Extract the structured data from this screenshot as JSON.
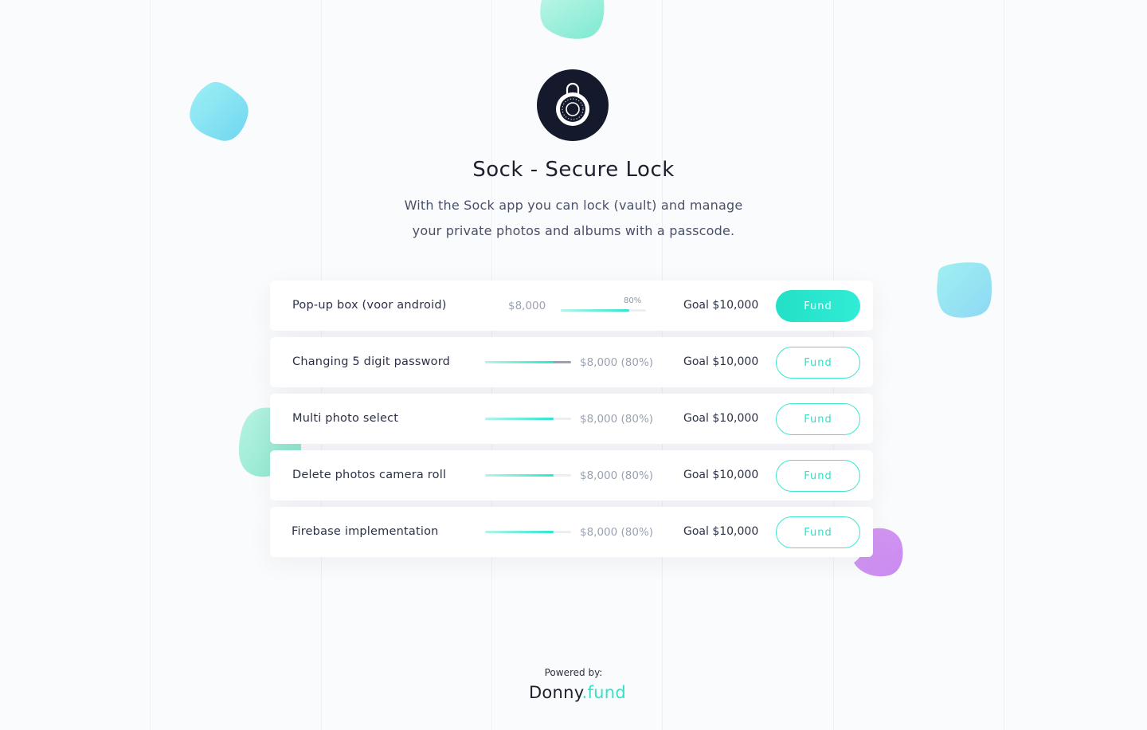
{
  "app": {
    "title": "Sock - Secure Lock",
    "description_line1": "With the Sock app you can lock (vault) and manage",
    "description_line2": "your private photos and albums with a passcode.",
    "logo_icon": "combination-lock-icon"
  },
  "colors": {
    "accent": "#2ee6cf",
    "logo_bg": "#141a2b",
    "blob_purple": "#c98cf0"
  },
  "features": [
    {
      "name": "Pop-up box (voor android)",
      "amount": "$8,000",
      "percent_label": "80%",
      "progress": 0.8,
      "goal": "Goal $10,000",
      "button": "Fund",
      "active": true
    },
    {
      "name": "Changing 5 digit password",
      "amount": "$8,000 (80%)",
      "progress": 0.8,
      "goal": "Goal $10,000",
      "button": "Fund",
      "active": false
    },
    {
      "name": "Multi photo select",
      "amount": "$8,000 (80%)",
      "progress": 0.8,
      "goal": "Goal $10,000",
      "button": "Fund",
      "active": false
    },
    {
      "name": "Delete photos camera roll",
      "amount": "$8,000 (80%)",
      "progress": 0.8,
      "goal": "Goal $10,000",
      "button": "Fund",
      "active": false
    },
    {
      "name": "Firebase implementation",
      "amount": "$8,000 (80%)",
      "progress": 0.8,
      "goal": "Goal $10,000",
      "button": "Fund",
      "active": false
    }
  ],
  "footer": {
    "powered_by": "Powered by:",
    "brand_main": "Donny",
    "brand_accent": ".fund"
  }
}
